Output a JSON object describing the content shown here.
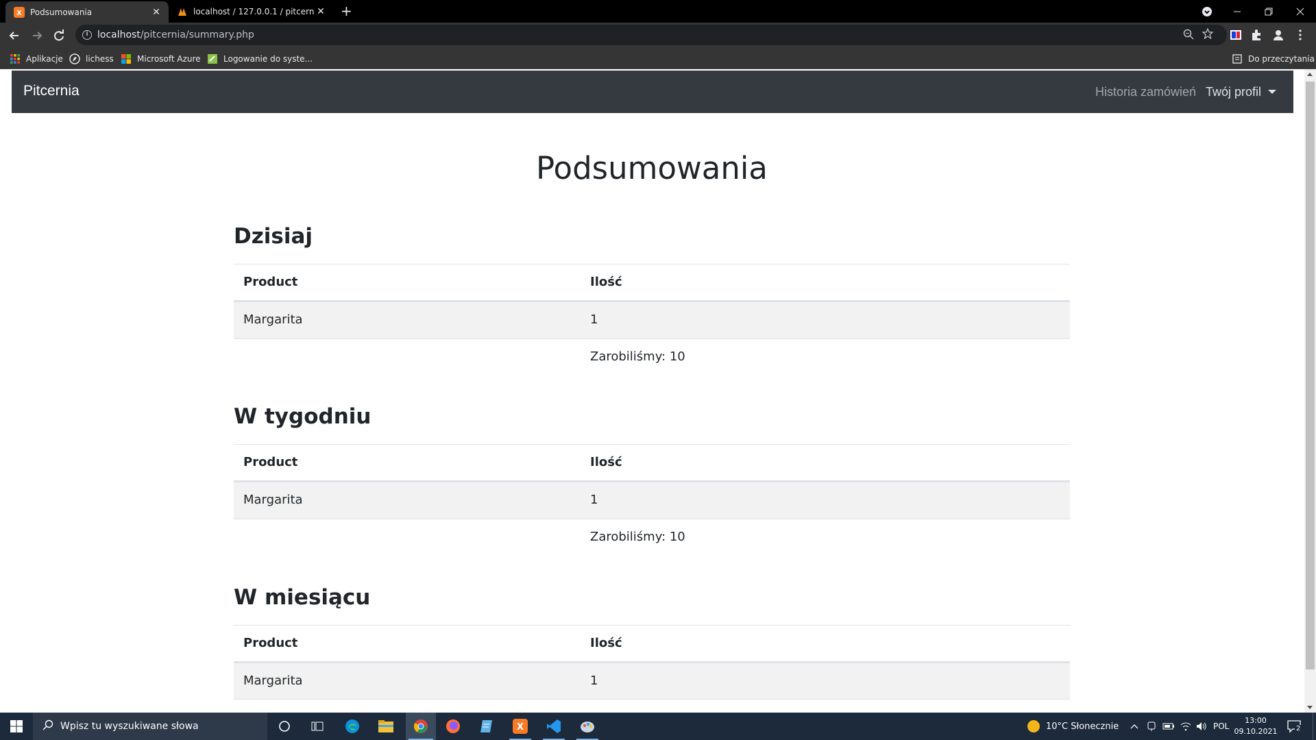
{
  "browser": {
    "tabs": [
      {
        "title": "Podsumowania",
        "active": true
      },
      {
        "title": "localhost / 127.0.0.1 / pitcernia /",
        "active": false
      }
    ],
    "new_tab_symbol": "+",
    "close_symbol": "✕",
    "url_host": "localhost",
    "url_path": "/pitcernia/summary.php",
    "bookmarks": [
      {
        "label": "Aplikacje",
        "icon": "apps-grid-icon"
      },
      {
        "label": "lichess",
        "icon": "lichess-icon"
      },
      {
        "label": "Microsoft Azure",
        "icon": "azure-icon"
      },
      {
        "label": "Logowanie do syste...",
        "icon": "login-icon"
      }
    ],
    "reading_list_label": "Do przeczytania"
  },
  "navbar": {
    "brand": "Pitcernia",
    "history_link": "Historia zamówień",
    "profile_link": "Twój profil"
  },
  "page": {
    "title": "Podsumowania",
    "sections": [
      {
        "heading": "Dzisiaj",
        "columns": [
          "Product",
          "Ilość"
        ],
        "rows": [
          [
            "Margarita",
            "1"
          ]
        ],
        "total": "Zarobiliśmy: 10"
      },
      {
        "heading": "W tygodniu",
        "columns": [
          "Product",
          "Ilość"
        ],
        "rows": [
          [
            "Margarita",
            "1"
          ]
        ],
        "total": "Zarobiliśmy: 10"
      },
      {
        "heading": "W miesiącu",
        "columns": [
          "Product",
          "Ilość"
        ],
        "rows": [
          [
            "Margarita",
            "1"
          ]
        ]
      }
    ]
  },
  "taskbar": {
    "search_placeholder": "Wpisz tu wyszukiwane słowa",
    "weather": "10°C  Słonecznie",
    "language": "POL",
    "time": "13:00",
    "date": "09.10.2021",
    "notifications": "2"
  },
  "colors": {
    "navbar_bg": "#343a40",
    "taskbar_bg": "#1c2a3b",
    "table_stripe": "#f2f2f2"
  }
}
